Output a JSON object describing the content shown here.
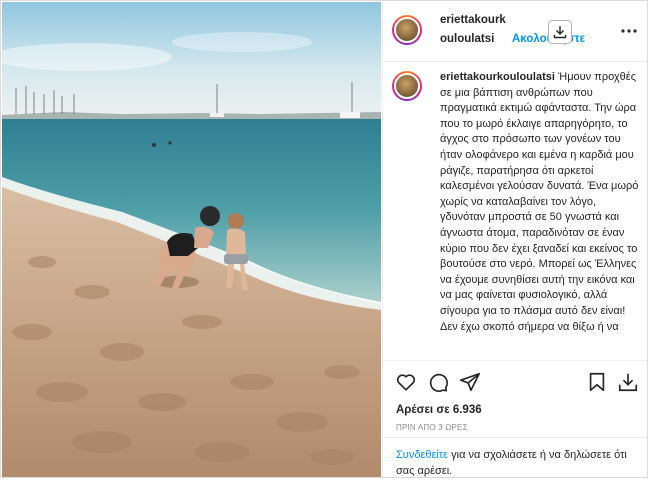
{
  "header": {
    "username_line1": "eriettakourk",
    "username_line2": "ouloulatsi",
    "follow_label": "Ακολουθήστε"
  },
  "caption": {
    "username": "eriettakourkouloulatsi",
    "text": "Ήμουν προχθές σε μια βάπτιση ανθρώπων που πραγματικά εκτιμώ αφάνταστα. Την ώρα που το μωρό έκλαιγε απαρηγόρητο, το άγχος στο πρόσωπο των γονέων του ήταν ολοφάνερο και εμένα η καρδιά μου ράγιζε, παρατήρησα ότι αρκετοί καλεσμένοι γελούσαν δυνατά. Ένα μωρό χωρίς να καταλαβαίνει τον λόγο, γδυνόταν μπροστά σε 50 γνωστά και άγνωστα άτομα, παραδινόταν σε έναν κύριο που δεν έχει ξαναδεί και εκείνος το βουτούσε στο νερό. Μπορεί ως Έλληνες να έχουμε συνηθίσει αυτή την εικόνα και να μας φαίνεται φυσιολογικό, αλλά σίγουρα για το πλάσμα αυτό δεν είναι! Δεν έχω σκοπό σήμερα να θίξω ή να"
  },
  "actions": {
    "likes": "Αρέσει σε 6.936",
    "time": "ΠΡΙΝ ΑΠΟ 3 ΩΡΕΣ",
    "login_link": "Συνδεθείτε",
    "login_rest": " για να σχολιάσετε ή να δηλώσετε ότι σας αρέσει."
  },
  "icons": {
    "download": "download-icon",
    "more": "more-options-icon",
    "like": "heart-icon",
    "comment": "comment-icon",
    "share": "share-icon",
    "save": "bookmark-icon",
    "download_bottom": "download-icon"
  },
  "colors": {
    "link": "#0095f6",
    "text": "#262626",
    "muted": "#8e8e8e",
    "sea": "#3f8f9a",
    "sand": "#c9a98a"
  }
}
